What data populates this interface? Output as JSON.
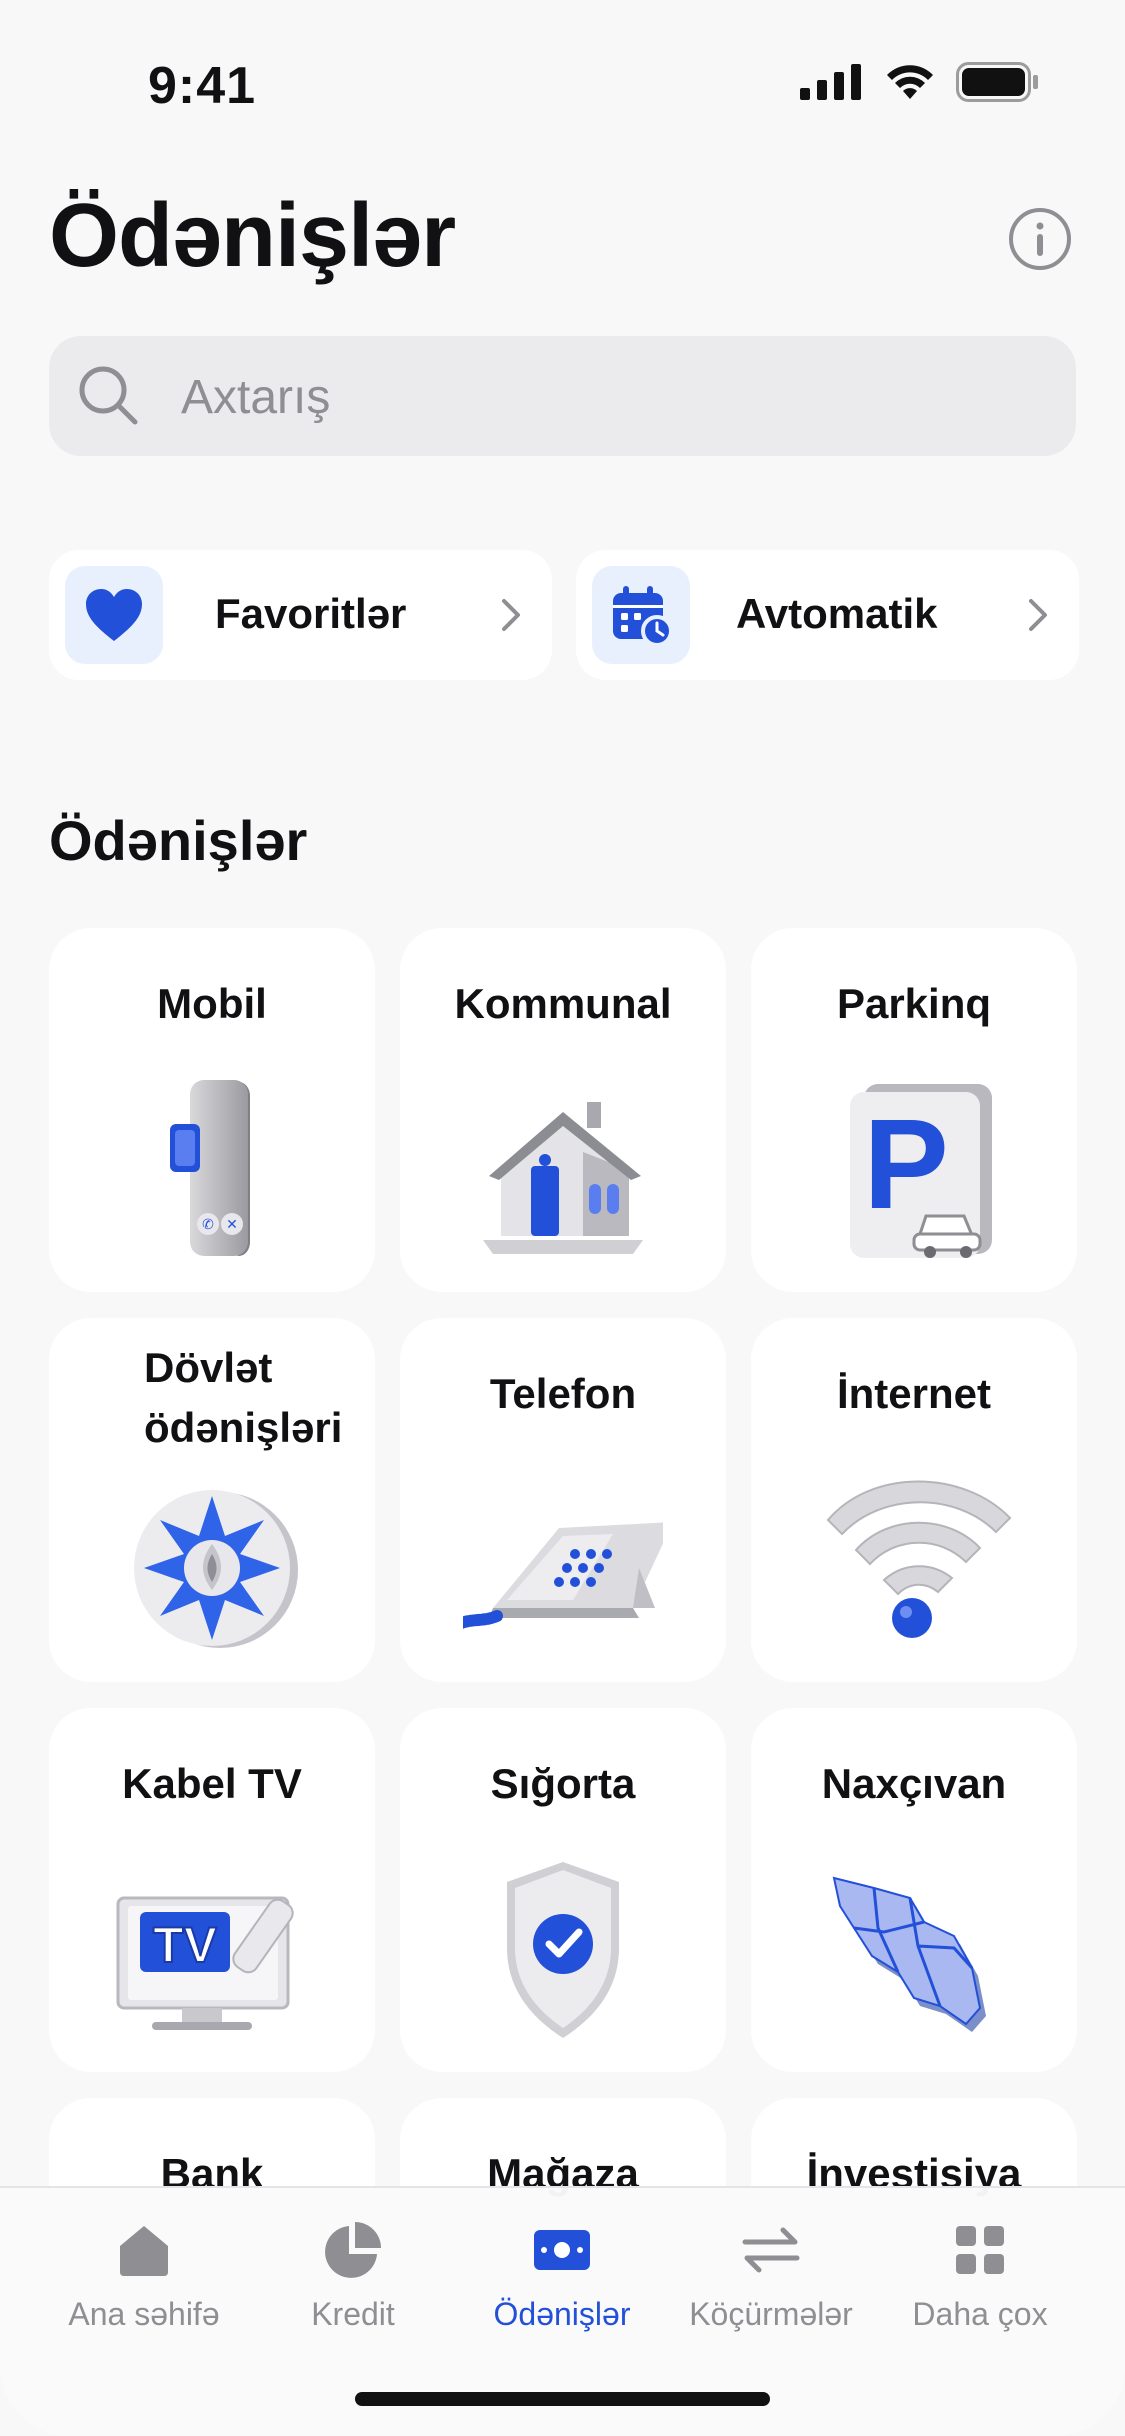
{
  "status_bar": {
    "time": "9:41"
  },
  "header": {
    "title": "Ödənişlər"
  },
  "search": {
    "placeholder": "Axtarış",
    "value": ""
  },
  "shortcuts": [
    {
      "label": "Favoritlər",
      "icon": "heart-icon"
    },
    {
      "label": "Avtomatik",
      "icon": "calendar-clock-icon"
    }
  ],
  "section": {
    "title": "Ödənişlər"
  },
  "categories": [
    {
      "label": "Mobil",
      "icon": "mobile-phone-icon"
    },
    {
      "label": "Kommunal",
      "icon": "house-icon"
    },
    {
      "label": "Parkinq",
      "icon": "parking-icon"
    },
    {
      "label": "Dövlət ödənişləri",
      "icon": "state-emblem-icon"
    },
    {
      "label": "Telefon",
      "icon": "desk-phone-icon"
    },
    {
      "label": "İnternet",
      "icon": "wifi-icon"
    },
    {
      "label": "Kabel TV",
      "icon": "tv-icon"
    },
    {
      "label": "Sığorta",
      "icon": "shield-check-icon"
    },
    {
      "label": "Naxçıvan",
      "icon": "map-icon"
    },
    {
      "label": "Bank",
      "icon": "bank-icon"
    },
    {
      "label": "Mağaza",
      "icon": "shop-icon"
    },
    {
      "label": "İnvestisiya",
      "icon": "investment-icon"
    }
  ],
  "tabbar": {
    "active": "Ödənişlər",
    "items": [
      {
        "label": "Ana səhifə",
        "icon": "home-icon"
      },
      {
        "label": "Kredit",
        "icon": "pie-chart-icon"
      },
      {
        "label": "Ödənişlər",
        "icon": "payments-icon"
      },
      {
        "label": "Köçürmələr",
        "icon": "transfer-arrows-icon"
      },
      {
        "label": "Daha çox",
        "icon": "grid-icon"
      }
    ]
  },
  "colors": {
    "accent": "#2350d8",
    "background": "#f8f8f9",
    "card": "#ffffff",
    "muted": "#8e8e93"
  }
}
